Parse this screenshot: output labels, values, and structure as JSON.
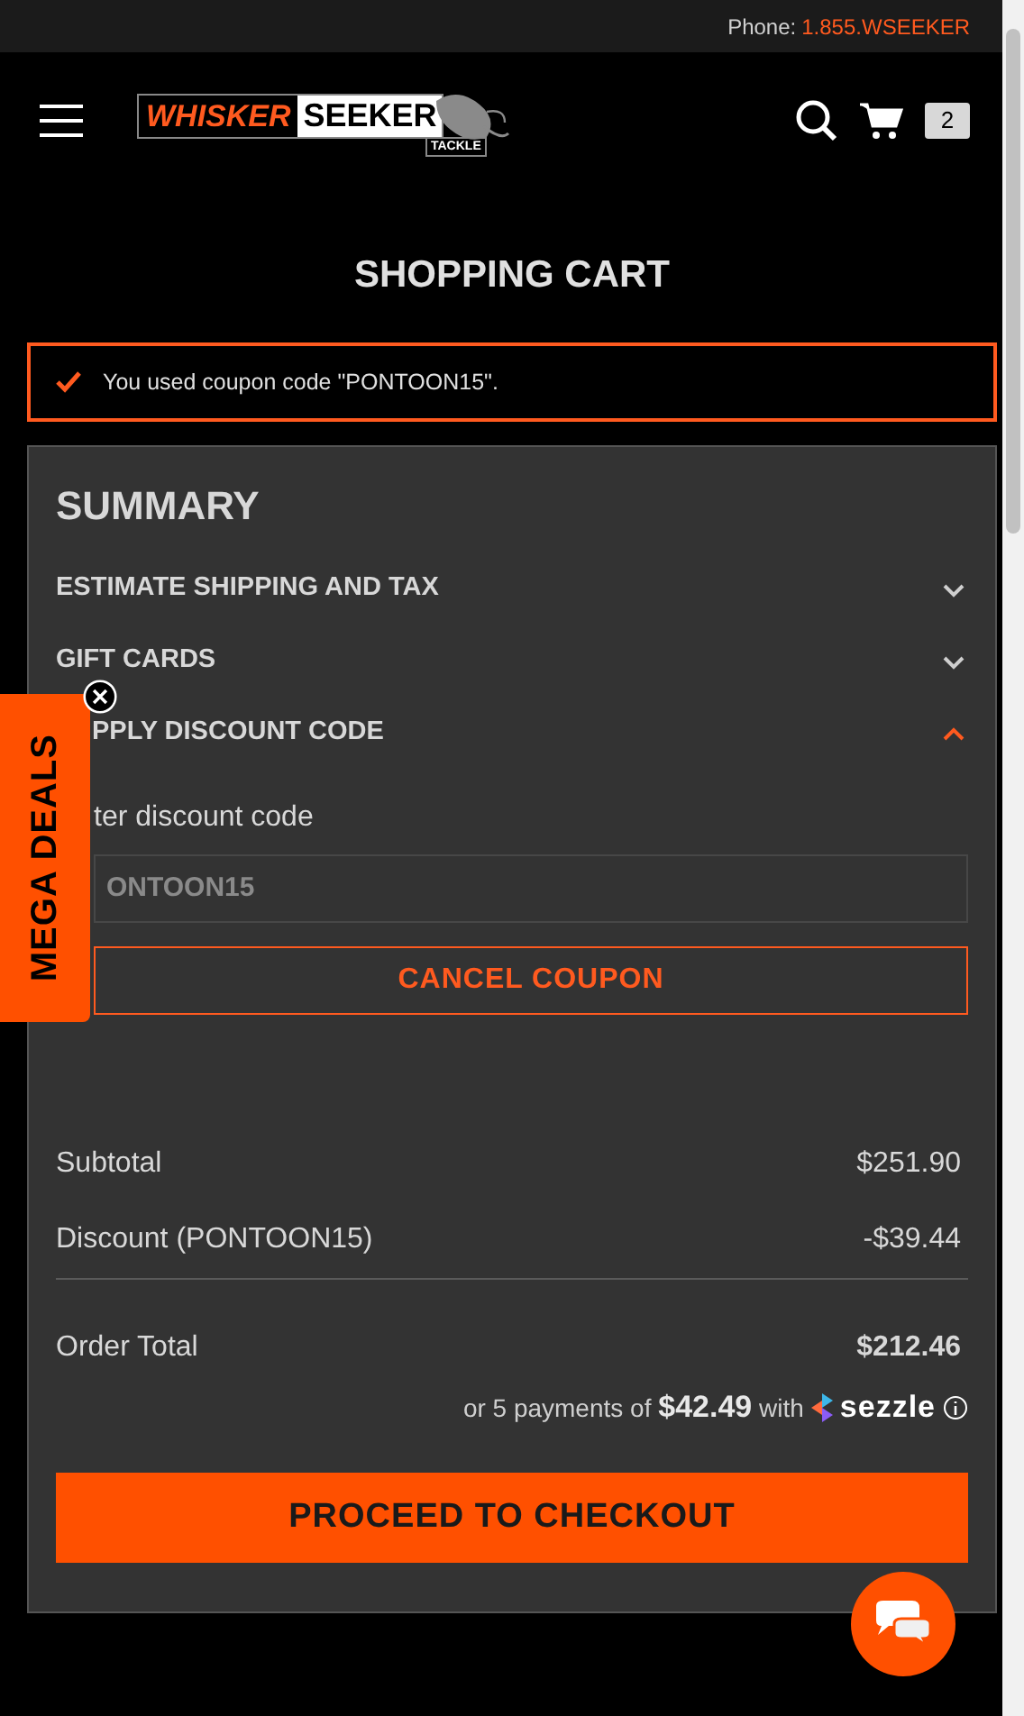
{
  "top_bar": {
    "phone_label": "Phone:",
    "phone_number": "1.855.WSEEKER"
  },
  "header": {
    "logo": {
      "word_1": "WHISKER",
      "word_2": "SEEKER",
      "word_3": "TACKLE"
    },
    "cart_count": "2"
  },
  "page_title": "SHOPPING CART",
  "message": {
    "text": "You used coupon code \"PONTOON15\"."
  },
  "summary": {
    "title": "SUMMARY",
    "sections": [
      {
        "label": "ESTIMATE SHIPPING AND TAX",
        "expanded": false
      },
      {
        "label": "GIFT CARDS",
        "expanded": false
      },
      {
        "label": "PPLY DISCOUNT CODE",
        "expanded": true
      }
    ],
    "discount": {
      "label": "ter discount code",
      "value": "ONTOON15",
      "button": "CANCEL COUPON"
    },
    "totals": [
      {
        "label": "Subtotal",
        "value": "$251.90",
        "kind": "plain"
      },
      {
        "label": "Discount (PONTOON15)",
        "value": "-$39.44",
        "kind": "plain"
      },
      {
        "label": "Order Total",
        "value": "$212.46",
        "kind": "grand"
      }
    ],
    "installments": {
      "prefix": "or 5 payments of",
      "amount": "$42.49",
      "suffix": "with",
      "brand": "sezzle"
    },
    "checkout_button": "PROCEED TO CHECKOUT"
  },
  "promo_tab": {
    "label": "MEGA DEALS"
  }
}
